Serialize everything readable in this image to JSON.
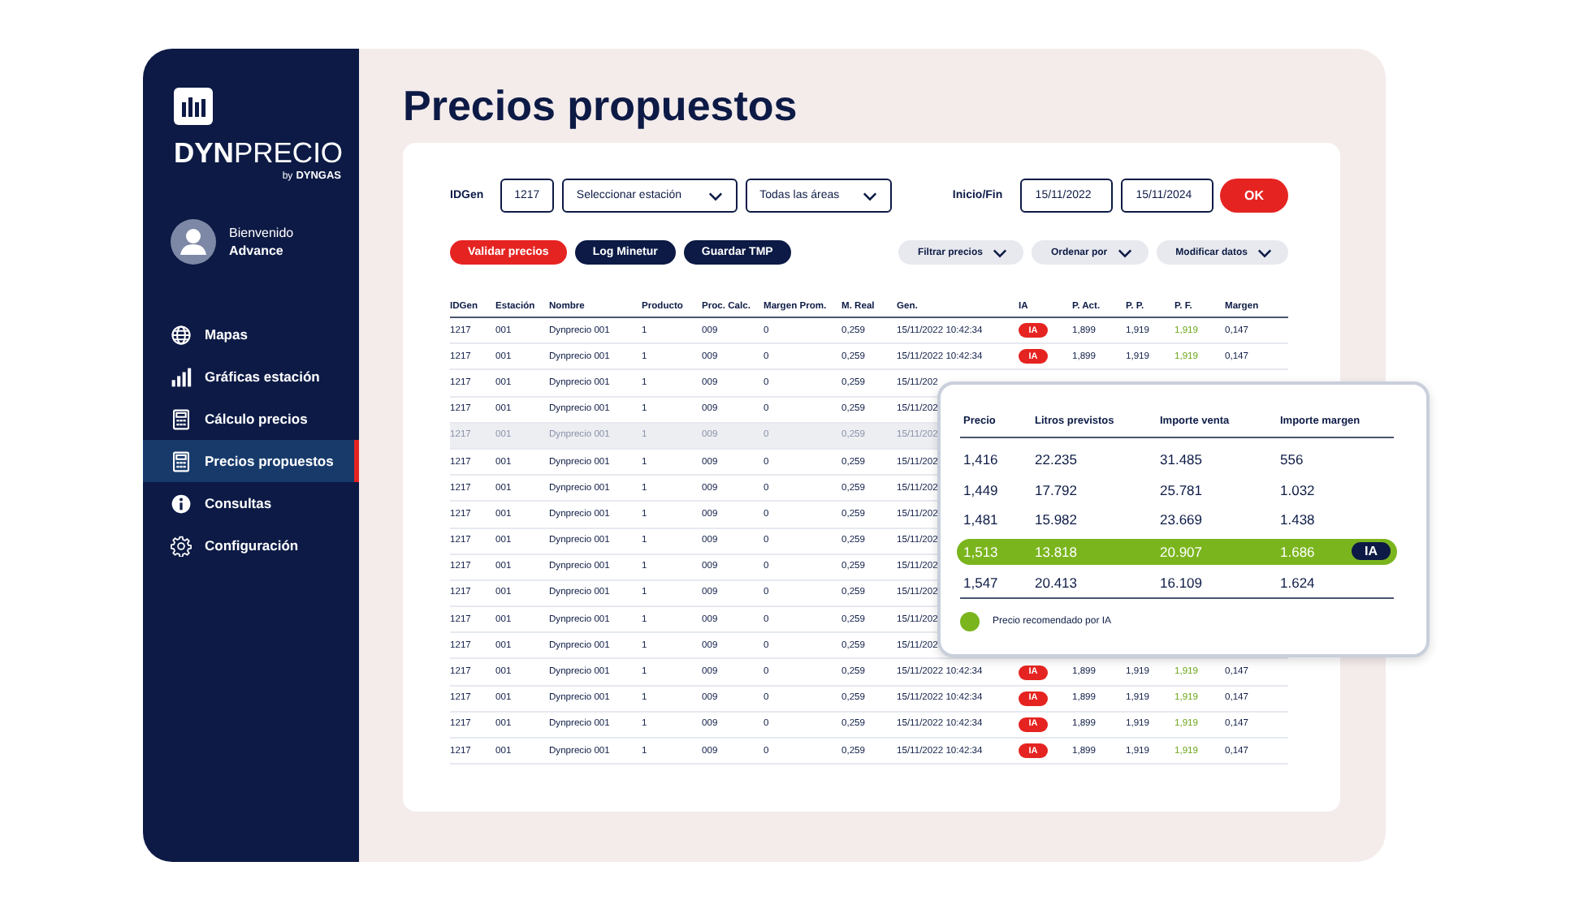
{
  "sidebar": {
    "logo": {
      "brand_bold": "DYN",
      "brand_light": "PRECIO",
      "by": "by",
      "company": "DYNGAS"
    },
    "user": {
      "greeting": "Bienvenido",
      "name": "Advance"
    },
    "items": [
      {
        "label": "Mapas",
        "selected": false
      },
      {
        "label": "Gráficas estación",
        "selected": false
      },
      {
        "label": "Cálculo precios",
        "selected": false
      },
      {
        "label": "Precios propuestos",
        "selected": true
      },
      {
        "label": "Consultas",
        "selected": false
      },
      {
        "label": "Configuración",
        "selected": false
      }
    ]
  },
  "page": {
    "title": "Precios propuestos"
  },
  "filters": {
    "idgen_label": "IDGen",
    "idgen": "1217",
    "station": "Seleccionar estación",
    "area": "Todas las áreas",
    "date_label": "Inicio/Fin",
    "start": "15/11/2022",
    "end": "15/11/2024",
    "ok": "OK"
  },
  "actions": [
    {
      "label": "Validar precios",
      "kind": "primary"
    },
    {
      "label": "Log Minetur",
      "kind": "dark"
    },
    {
      "label": "Guardar TMP",
      "kind": "dark"
    }
  ],
  "menus": [
    "Filtrar precios",
    "Ordenar por",
    "Modificar datos"
  ],
  "table": {
    "columns": [
      {
        "label": "IDGen",
        "kind": "text"
      },
      {
        "label": "Estación",
        "kind": "text"
      },
      {
        "label": "Nombre",
        "kind": "text"
      },
      {
        "label": "Producto",
        "kind": "text"
      },
      {
        "label": "Proc. Calc.",
        "kind": "text"
      },
      {
        "label": "Margen Prom.",
        "kind": "text"
      },
      {
        "label": "M. Real",
        "kind": "text"
      },
      {
        "label": "Gen.",
        "kind": "text"
      },
      {
        "label": "IA",
        "kind": "badge"
      },
      {
        "label": "P. Act.",
        "kind": "text"
      },
      {
        "label": "P. P.",
        "kind": "text"
      },
      {
        "label": "P. F.",
        "kind": "highlight"
      },
      {
        "label": "Margen",
        "kind": "text"
      }
    ],
    "rows": [
      {
        "selected": false,
        "cells": [
          "1217",
          "001",
          "Dynprecio 001",
          "1",
          "009",
          "0",
          "0,259",
          "15/11/2022 10:42:34",
          "IA",
          "1,899",
          "1,919",
          "1,919",
          "0,147"
        ]
      },
      {
        "selected": false,
        "cells": [
          "1217",
          "001",
          "Dynprecio 001",
          "1",
          "009",
          "0",
          "0,259",
          "15/11/2022 10:42:34",
          "IA",
          "1,899",
          "1,919",
          "1,919",
          "0,147"
        ]
      },
      {
        "selected": false,
        "cells": [
          "1217",
          "001",
          "Dynprecio 001",
          "1",
          "009",
          "0",
          "0,259",
          "15/11/202"
        ]
      },
      {
        "selected": false,
        "cells": [
          "1217",
          "001",
          "Dynprecio 001",
          "1",
          "009",
          "0",
          "0,259",
          "15/11/202"
        ]
      },
      {
        "selected": true,
        "cells": [
          "1217",
          "001",
          "Dynprecio 001",
          "1",
          "009",
          "0",
          "0,259",
          "15/11/202"
        ]
      },
      {
        "selected": false,
        "cells": [
          "1217",
          "001",
          "Dynprecio 001",
          "1",
          "009",
          "0",
          "0,259",
          "15/11/202"
        ]
      },
      {
        "selected": false,
        "cells": [
          "1217",
          "001",
          "Dynprecio 001",
          "1",
          "009",
          "0",
          "0,259",
          "15/11/202"
        ]
      },
      {
        "selected": false,
        "cells": [
          "1217",
          "001",
          "Dynprecio 001",
          "1",
          "009",
          "0",
          "0,259",
          "15/11/202"
        ]
      },
      {
        "selected": false,
        "cells": [
          "1217",
          "001",
          "Dynprecio 001",
          "1",
          "009",
          "0",
          "0,259",
          "15/11/202"
        ]
      },
      {
        "selected": false,
        "cells": [
          "1217",
          "001",
          "Dynprecio 001",
          "1",
          "009",
          "0",
          "0,259",
          "15/11/202"
        ]
      },
      {
        "selected": false,
        "cells": [
          "1217",
          "001",
          "Dynprecio 001",
          "1",
          "009",
          "0",
          "0,259",
          "15/11/202"
        ]
      },
      {
        "selected": false,
        "cells": [
          "1217",
          "001",
          "Dynprecio 001",
          "1",
          "009",
          "0",
          "0,259",
          "15/11/202"
        ]
      },
      {
        "selected": false,
        "cells": [
          "1217",
          "001",
          "Dynprecio 001",
          "1",
          "009",
          "0",
          "0,259",
          "15/11/202"
        ]
      },
      {
        "selected": false,
        "cells": [
          "1217",
          "001",
          "Dynprecio 001",
          "1",
          "009",
          "0",
          "0,259",
          "15/11/2022 10:42:34",
          "IA",
          "1,899",
          "1,919",
          "1,919",
          "0,147"
        ]
      },
      {
        "selected": false,
        "cells": [
          "1217",
          "001",
          "Dynprecio 001",
          "1",
          "009",
          "0",
          "0,259",
          "15/11/2022 10:42:34",
          "IA",
          "1,899",
          "1,919",
          "1,919",
          "0,147"
        ]
      },
      {
        "selected": false,
        "cells": [
          "1217",
          "001",
          "Dynprecio 001",
          "1",
          "009",
          "0",
          "0,259",
          "15/11/2022 10:42:34",
          "IA",
          "1,899",
          "1,919",
          "1,919",
          "0,147"
        ]
      },
      {
        "selected": false,
        "cells": [
          "1217",
          "001",
          "Dynprecio 001",
          "1",
          "009",
          "0",
          "0,259",
          "15/11/2022 10:42:34",
          "IA",
          "1,899",
          "1,919",
          "1,919",
          "0,147"
        ]
      }
    ]
  },
  "popup": {
    "columns": [
      "Precio",
      "Litros previstos",
      "Importe venta",
      "Importe margen"
    ],
    "rows": [
      {
        "recommended": false,
        "cells": [
          "1,416",
          "22.235",
          "31.485",
          "556"
        ]
      },
      {
        "recommended": false,
        "cells": [
          "1,449",
          "17.792",
          "25.781",
          "1.032"
        ]
      },
      {
        "recommended": false,
        "cells": [
          "1,481",
          "15.982",
          "23.669",
          "1.438"
        ]
      },
      {
        "recommended": true,
        "cells": [
          "1,513",
          "13.818",
          "20.907",
          "1.686"
        ],
        "tag": "IA"
      },
      {
        "recommended": false,
        "cells": [
          "1,547",
          "20.413",
          "16.109",
          "1.624"
        ]
      }
    ],
    "legend": "Precio recomendado por IA"
  }
}
